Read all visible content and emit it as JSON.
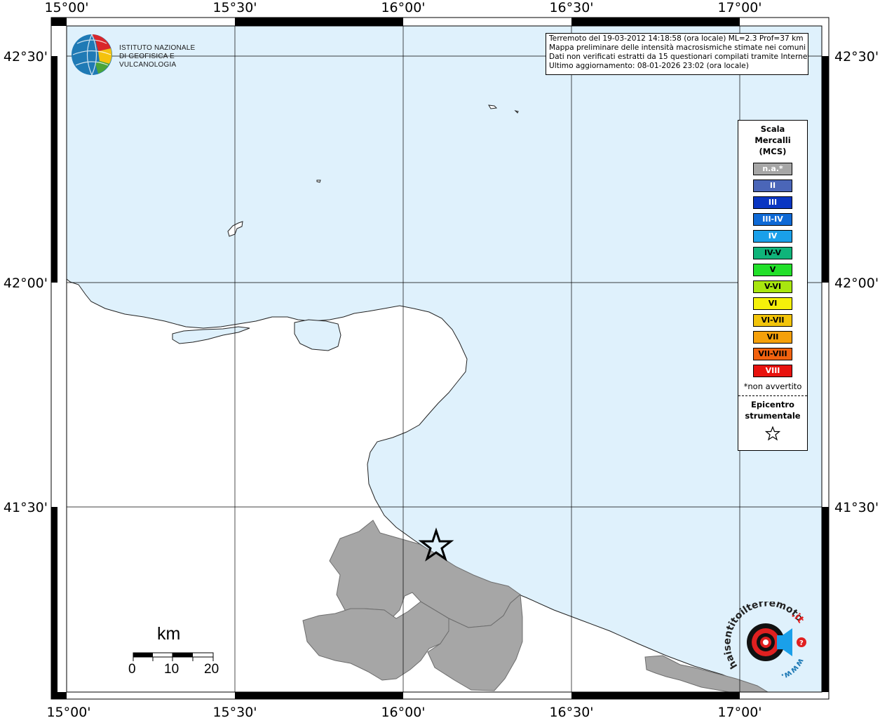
{
  "map": {
    "lon_labels": [
      "15°00'",
      "15°30'",
      "16°00'",
      "16°30'",
      "17°00'"
    ],
    "lat_labels": [
      "42°30'",
      "42°00'",
      "41°30'"
    ],
    "colors": {
      "sea": "#dff1fc",
      "land": "#ffffff",
      "affected_municipalities": "#a6a6a6",
      "grid": "#000000"
    },
    "epicenter_symbol": "star-icon"
  },
  "info": {
    "line1": "Terremoto del 19-03-2012 14:18:58 (ora locale) ML=2.3 Prof=37 km",
    "line2": "Mappa preliminare delle intensità macrosismiche stimate nei comuni",
    "line3": "Dati non verificati estratti da 15 questionari compilati tramite Internet.",
    "line4": "Ultimo aggiornamento: 08-01-2026 23:02 (ora locale)"
  },
  "legend": {
    "title_line1": "Scala",
    "title_line2": "Mercalli",
    "title_line3": "(MCS)",
    "items": [
      {
        "label": "n.a.*",
        "color": "#a6a6a6",
        "text_color": "#ffffff"
      },
      {
        "label": "II",
        "color": "#4b66b8",
        "text_color": "#ffffff"
      },
      {
        "label": "III",
        "color": "#0a36c2",
        "text_color": "#ffffff"
      },
      {
        "label": "III-IV",
        "color": "#0f6ad6",
        "text_color": "#ffffff"
      },
      {
        "label": "IV",
        "color": "#1aa0ea",
        "text_color": "#ffffff"
      },
      {
        "label": "IV-V",
        "color": "#0fb47a",
        "text_color": "#000000"
      },
      {
        "label": "V",
        "color": "#22e02a",
        "text_color": "#000000"
      },
      {
        "label": "V-VI",
        "color": "#a8e60f",
        "text_color": "#000000"
      },
      {
        "label": "VI",
        "color": "#f5f10a",
        "text_color": "#000000"
      },
      {
        "label": "VI-VII",
        "color": "#f2c40a",
        "text_color": "#000000"
      },
      {
        "label": "VII",
        "color": "#f5a00a",
        "text_color": "#000000"
      },
      {
        "label": "VII-VIII",
        "color": "#f2620f",
        "text_color": "#000000"
      },
      {
        "label": "VIII",
        "color": "#e8120e",
        "text_color": "#ffffff"
      }
    ],
    "note": "*non avvertito",
    "epicenter_line1": "Epicentro",
    "epicenter_line2": "strumentale"
  },
  "ingv": {
    "line1": "ISTITUTO NAZIONALE",
    "line2": "DI GEOFISICA E VULCANOLOGIA"
  },
  "scalebar": {
    "unit": "km",
    "ticks": [
      "0",
      "10",
      "20"
    ]
  },
  "hst": {
    "text_main": "haisentitoilterremoto",
    "text_tld": ".it",
    "text_www": "www."
  }
}
